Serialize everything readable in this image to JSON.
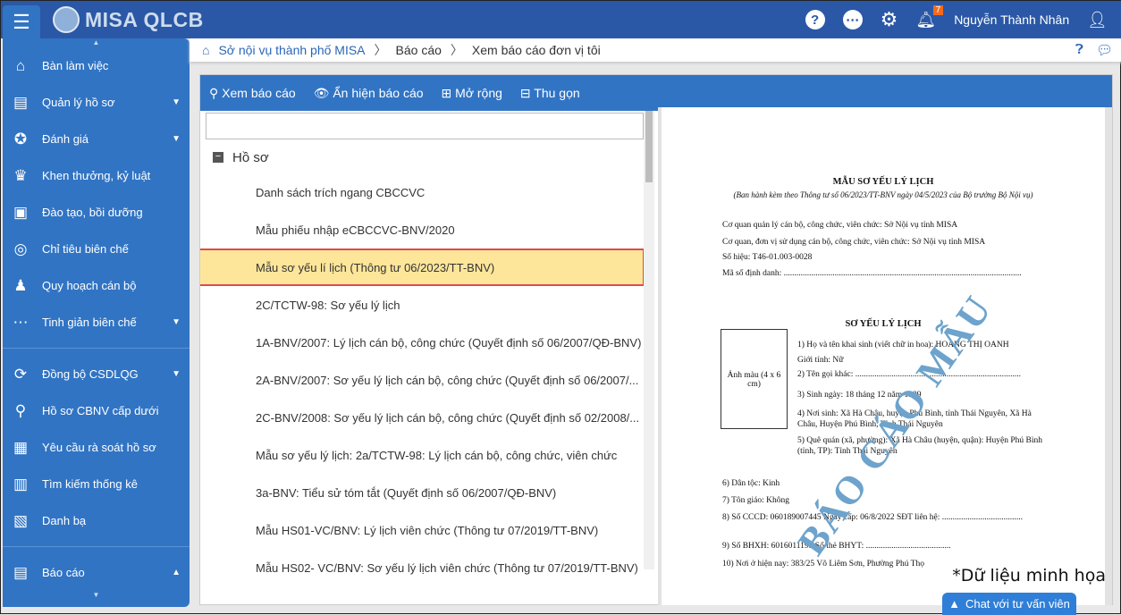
{
  "header": {
    "app_name": "MISA QLCB",
    "notification_count": "7",
    "user_name": "Nguyễn Thành Nhân"
  },
  "sidebar": {
    "items": [
      {
        "label": "Bàn làm việc",
        "icon": "home-icon",
        "g": "⌂"
      },
      {
        "label": "Quản lý hồ sơ",
        "icon": "id-card-icon",
        "g": "▤",
        "caret": true
      },
      {
        "label": "Đánh giá",
        "icon": "medal-icon",
        "g": "✪",
        "caret": true
      },
      {
        "label": "Khen thưởng, kỷ luật",
        "icon": "trophy-icon",
        "g": "♛"
      },
      {
        "label": "Đào tạo, bồi dưỡng",
        "icon": "training-icon",
        "g": "▣"
      },
      {
        "label": "Chỉ tiêu biên chế",
        "icon": "target-icon",
        "g": "◎"
      },
      {
        "label": "Quy hoạch cán bộ",
        "icon": "people-icon",
        "g": "♟"
      },
      {
        "label": "Tinh giản biên chế",
        "icon": "more-icon",
        "g": "⋯",
        "caret": true
      }
    ],
    "items2": [
      {
        "label": "Đồng bộ CSDLQG",
        "icon": "sync-icon",
        "g": "⟳",
        "caret": true
      },
      {
        "label": "Hồ sơ CBNV cấp dưới",
        "icon": "search-icon",
        "g": "⚲"
      },
      {
        "label": "Yêu cầu rà soát hồ sơ",
        "icon": "document-icon",
        "g": "▦"
      },
      {
        "label": "Tìm kiếm thống kê",
        "icon": "bar-chart-icon",
        "g": "▥"
      },
      {
        "label": "Danh bạ",
        "icon": "contacts-icon",
        "g": "▧"
      }
    ],
    "items3": [
      {
        "label": "Báo cáo",
        "icon": "report-icon",
        "g": "▤",
        "caret": true
      }
    ]
  },
  "breadcrumb": [
    "Sở nội vụ thành phố MISA",
    "Báo cáo",
    "Xem báo cáo đơn vị tôi"
  ],
  "toolbar": {
    "view": "Xem báo cáo",
    "hide": "Ẩn hiện báo cáo",
    "expand": "Mở rộng",
    "collapse": "Thu gọn"
  },
  "tree": {
    "root": "Hồ sơ",
    "items": [
      "Danh sách trích ngang CBCCVC",
      "Mẫu phiếu nhập eCBCCVC-BNV/2020",
      "Mẫu sơ yếu lí lịch (Thông tư 06/2023/TT-BNV)",
      "2C/TCTW-98: Sơ yếu lý lịch",
      "1A-BNV/2007: Lý lịch cán bộ, công chức (Quyết định số 06/2007/QĐ-BNV)",
      "2A-BNV/2007: Sơ yếu lý lịch cán bộ, công chức (Quyết định số 06/2007/...",
      "2C-BNV/2008: Sơ yếu lý lịch cán bộ, công chức (Quyết định số 02/2008/...",
      "Mẫu sơ yếu lý lịch: 2a/TCTW-98: Lý lịch cán bộ, công chức, viên chức",
      "3a-BNV: Tiểu sử tóm tắt (Quyết định số 06/2007/QĐ-BNV)",
      "Mẫu HS01-VC/BNV: Lý lịch viên chức (Thông tư 07/2019/TT-BNV)",
      "Mẫu HS02- VC/BNV: Sơ yếu lý lịch viên chức (Thông tư 07/2019/TT-BNV)"
    ],
    "selected_index": 2
  },
  "preview": {
    "title": "MẪU SƠ YẾU LÝ LỊCH",
    "subtitle": "(Ban hành kèm theo Thông tư số 06/2023/TT-BNV ngày 04/5/2023 của Bộ trưởng Bộ Nội vụ)",
    "l1": "Cơ quan quản lý cán bộ, công chức, viên chức: Sở Nội vụ tỉnh MISA",
    "l2": "Cơ quan, đơn vị sử dụng cán bộ, công chức, viên chức: Sở Nội vụ tỉnh MISA",
    "l3": "Số hiệu: T46-01.003-0028",
    "l4": "Mã số định danh: ................................................................................................................",
    "heading": "SƠ YẾU LÝ LỊCH",
    "photo": "Ảnh màu (4 x 6 cm)",
    "f1": "1) Họ và tên khai sinh (viết chữ in hoa): HOÀNG THỊ OANH",
    "f1b": "Giới tính: Nữ",
    "f2": "2) Tên gọi khác: ..............................................................................",
    "f3": "3) Sinh ngày: 18 tháng 12 năm 1989",
    "f4": "4) Nơi sinh: Xã Hà Châu, huyện Phú Bình, tỉnh Thái Nguyên, Xã Hà",
    "f4b": "Châu, Huyện Phú Bình, Tỉnh Thái Nguyên",
    "f5": "5) Quê quán (xã, phường): Xã Hà Châu (huyện, quận): Huyện Phú Bình",
    "f5b": "(tỉnh, TP): Tỉnh Thái Nguyên",
    "f6": "6) Dân tộc: Kinh",
    "f7": "7) Tôn giáo: Không",
    "f8": "8) Số CCCD: 060189007445  Ngày cấp: 06/8/2022  SĐT liên hệ: ......................................",
    "f9": "9) Số BHXH: 6016011198    Số thẻ BHYT: ........................................",
    "f10": "10) Nơi ở hiện nay: 383/25 Võ Liêm Sơn, Phường Phú Thọ",
    "watermark": "BÁO CÁO MẪU"
  },
  "note": "*Dữ liệu minh họa",
  "chat": "Chat với tư vấn viên",
  "colors": {
    "header": "#2a58a6",
    "sidebar": "#3174c4",
    "highlight": "#fde69a",
    "badge": "#f26b1d"
  }
}
